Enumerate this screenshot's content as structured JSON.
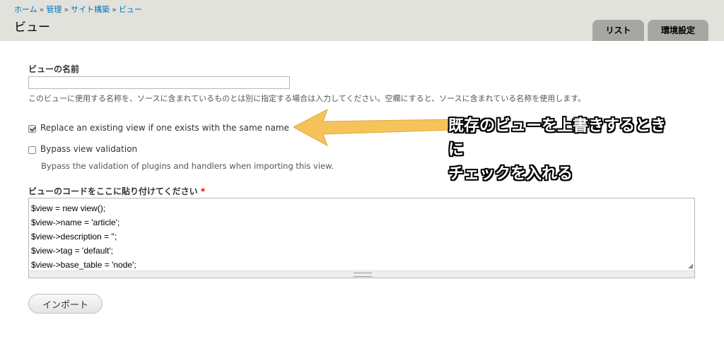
{
  "breadcrumb": {
    "items": [
      "ホーム",
      "管理",
      "サイト構築",
      "ビュー"
    ],
    "separator": "»"
  },
  "page_title": "ビュー",
  "tabs": [
    {
      "label": "リスト"
    },
    {
      "label": "環境設定"
    }
  ],
  "form": {
    "view_name_label": "ビューの名前",
    "view_name_value": "",
    "view_name_description": "このビューに使用する名称を、ソースに含まれているものとは別に指定する場合は入力してください。空欄にすると、ソースに含まれている名称を使用します。",
    "replace_label": "Replace an existing view if one exists with the same name",
    "replace_checked": true,
    "bypass_label": "Bypass view validation",
    "bypass_checked": false,
    "bypass_description": "Bypass the validation of plugins and handlers when importing this view.",
    "code_label": "ビューのコードをここに貼り付けてください",
    "code_required_marker": "*",
    "code_lines": [
      "$view = new view();",
      "$view->name = 'article';",
      "$view->description = '';",
      "$view->tag = 'default';",
      "$view->base_table = 'node';"
    ],
    "import_button": "インポート"
  },
  "annotation": {
    "lines": [
      "既存のビューを上書きするとき",
      "に",
      "チェックを入れる"
    ],
    "arrow_color": "#f6c35a"
  }
}
